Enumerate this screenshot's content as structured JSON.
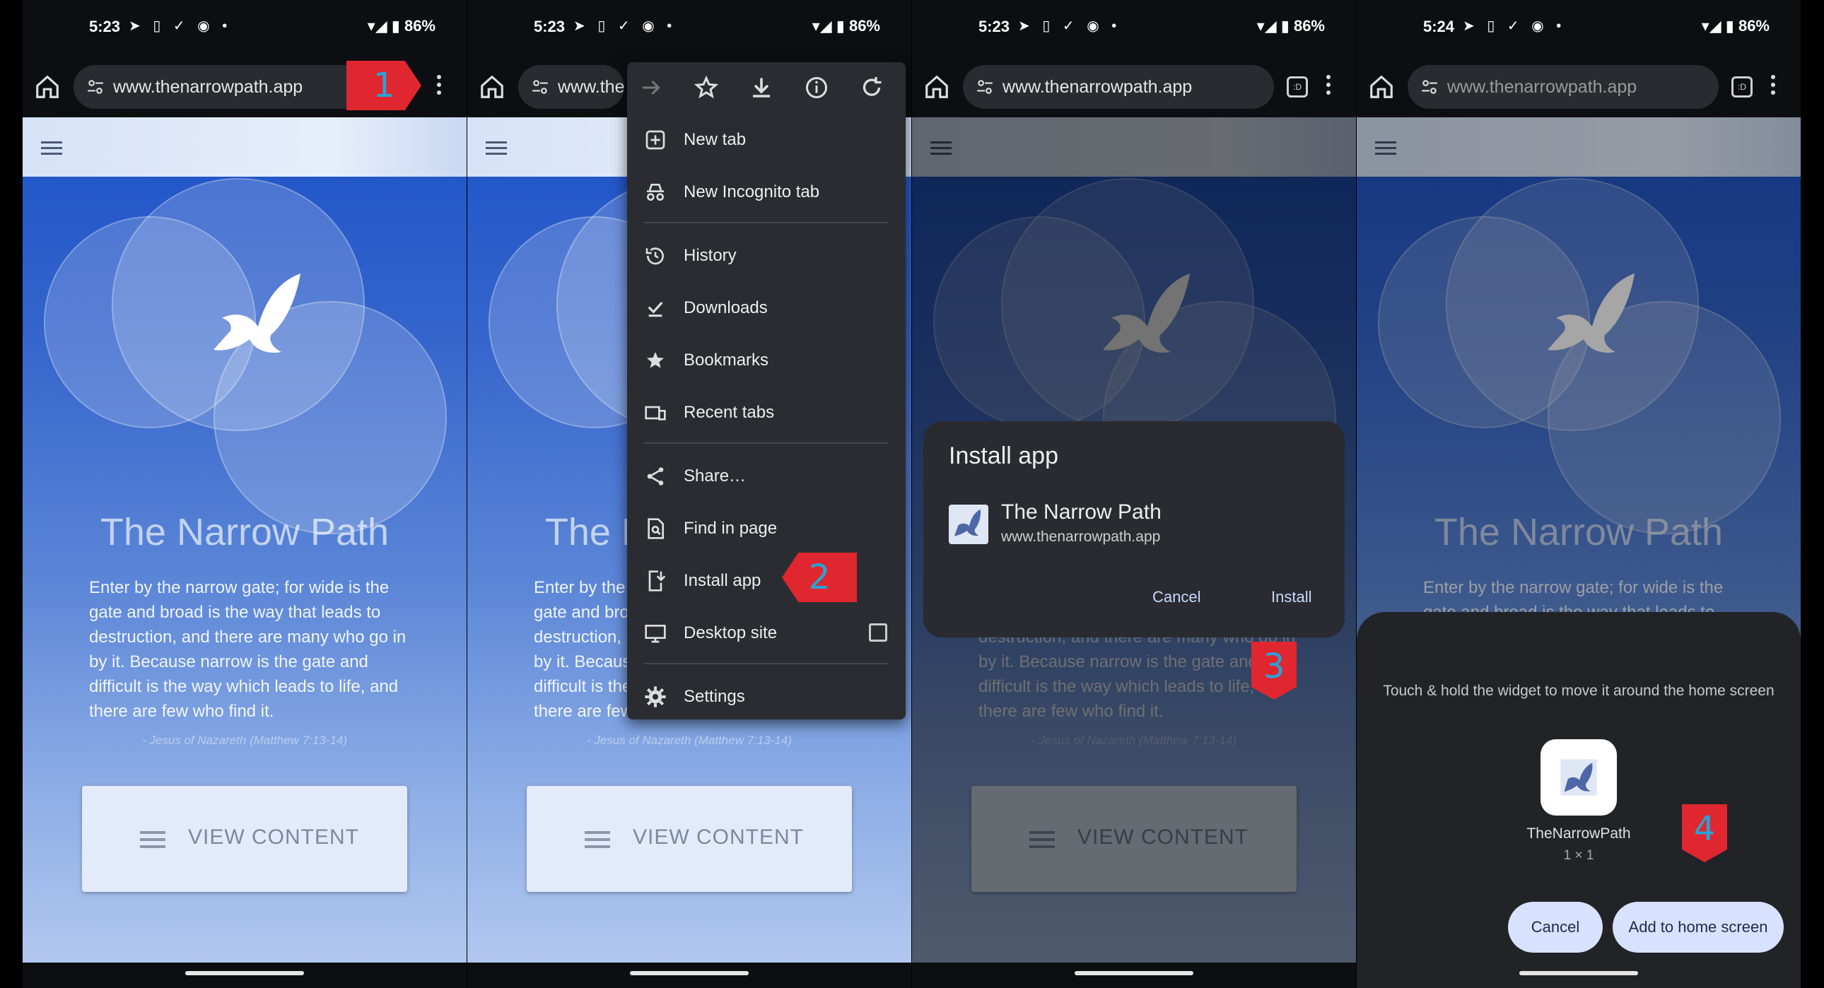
{
  "status": [
    {
      "time": "5:23",
      "battery": "86%"
    },
    {
      "time": "5:23",
      "battery": "86%"
    },
    {
      "time": "5:23",
      "battery": "86%"
    },
    {
      "time": "5:24",
      "battery": "86%"
    }
  ],
  "browser": {
    "url": "www.thenarrowpath.app",
    "url_truncated": "www.ther"
  },
  "page": {
    "title": "The Narrow Path",
    "verse": "Enter by the narrow gate; for wide is the gate and broad is the way that leads to destruction, and there are many who go in by it. Because narrow is the gate and difficult is the way which leads to life, and there are few who find it.",
    "citation": "- Jesus of Nazareth (Matthew 7:13-14)",
    "button_label": "VIEW CONTENT"
  },
  "menu": {
    "items": [
      "New tab",
      "New Incognito tab",
      "History",
      "Downloads",
      "Bookmarks",
      "Recent tabs",
      "Share…",
      "Find in page",
      "Install app",
      "Desktop site",
      "Settings"
    ]
  },
  "dialog": {
    "title": "Install app",
    "app_name": "The Narrow Path",
    "app_url": "www.thenarrowpath.app",
    "cancel": "Cancel",
    "install": "Install"
  },
  "widget_sheet": {
    "hint": "Touch & hold the widget to move it around the home screen",
    "widget_name": "TheNarrowPath",
    "widget_size": "1 × 1",
    "cancel": "Cancel",
    "add": "Add to home screen"
  },
  "steps": [
    "1",
    "2",
    "3",
    "4"
  ],
  "colors": {
    "badge": "#e0262f",
    "badge_text": "#27a4d6",
    "page_top": "#1d52c7"
  }
}
